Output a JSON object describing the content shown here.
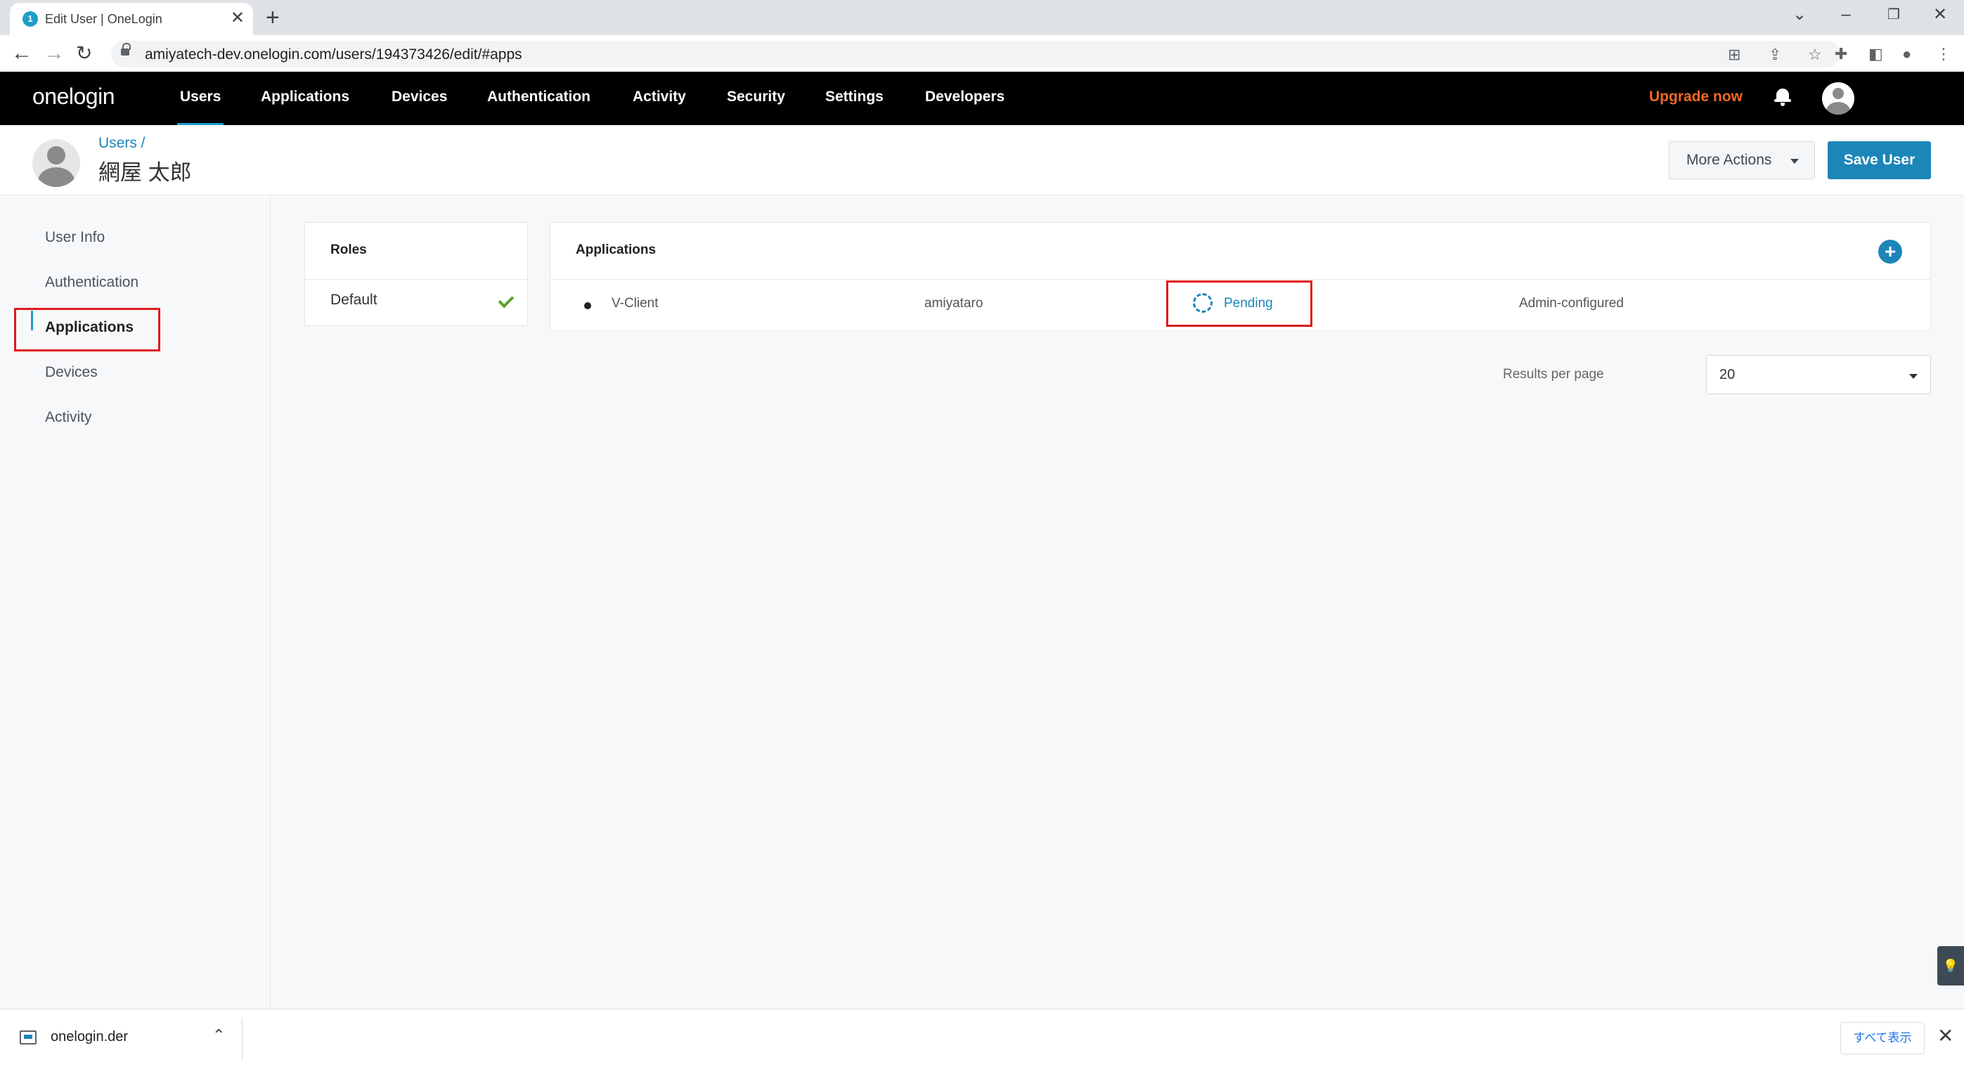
{
  "browser": {
    "tab_title": "Edit User | OneLogin",
    "tab_favicon": "1",
    "url": "amiyatech-dev.onelogin.com/users/194373426/edit/#apps"
  },
  "topnav": {
    "logo": "onelogin",
    "items": [
      "Users",
      "Applications",
      "Devices",
      "Authentication",
      "Activity",
      "Security",
      "Settings",
      "Developers"
    ],
    "active_item": "Users",
    "upgrade": "Upgrade now"
  },
  "header": {
    "breadcrumb": "Users /",
    "user_name": "網屋 太郎",
    "more_actions": "More Actions",
    "save_user": "Save User"
  },
  "sidebar": {
    "items": [
      "User Info",
      "Authentication",
      "Applications",
      "Devices",
      "Activity"
    ],
    "active_item": "Applications"
  },
  "roles": {
    "title": "Roles",
    "items": [
      {
        "name": "Default",
        "checked": true
      }
    ]
  },
  "applications": {
    "title": "Applications",
    "rows": [
      {
        "name": "V-Client",
        "login": "amiyataro",
        "status": "Pending",
        "type": "Admin-configured"
      }
    ]
  },
  "pagination": {
    "label": "Results per page",
    "value": "20"
  },
  "download_bar": {
    "file": "onelogin.der",
    "show_all": "すべて表示"
  },
  "colors": {
    "accent": "#1c86b8",
    "upgrade": "#f26722",
    "highlight": "#e01b1b",
    "check": "#5aa02c"
  }
}
